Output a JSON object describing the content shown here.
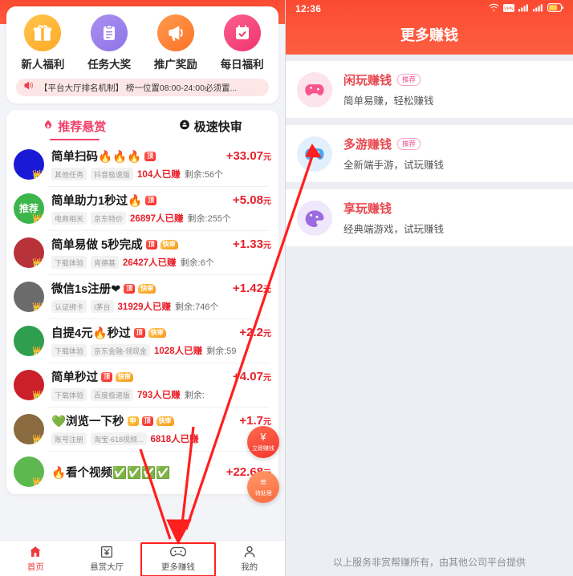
{
  "left": {
    "quick_actions": [
      {
        "label": "新人福利",
        "icon": "gift-icon"
      },
      {
        "label": "任务大奖",
        "icon": "clipboard-icon"
      },
      {
        "label": "推广奖励",
        "icon": "megaphone-icon"
      },
      {
        "label": "每日福利",
        "icon": "calendar-check-icon"
      }
    ],
    "notice": {
      "icon": "speaker-icon",
      "text": "【平台大厅排名机制】 榜一位置08:00-24:00必须置..."
    },
    "tabs": [
      {
        "label": "推荐悬赏",
        "icon": "flame-icon",
        "active": true
      },
      {
        "label": "极速快审",
        "icon": "rocket-icon",
        "active": false
      }
    ],
    "tasks": [
      {
        "title": "简单扫码🔥🔥🔥",
        "badges": [
          "顶"
        ],
        "amount": "+33.07",
        "unit": "元",
        "chips": [
          "其他任务",
          "抖音极速版"
        ],
        "earned": "104人已赚",
        "remain": "剩余:56个",
        "avatar_color": "#1a1ad6",
        "avatar_text": ""
      },
      {
        "title": "简单助力1秒过🔥",
        "badges": [
          "顶"
        ],
        "amount": "+5.08",
        "unit": "元",
        "chips": [
          "电商相关",
          "京东特价"
        ],
        "earned": "26897人已赚",
        "remain": "剩余:255个",
        "avatar_color": "#3cb54a",
        "avatar_text": "推荐"
      },
      {
        "title": "简单易做 5秒完成",
        "badges": [
          "顶",
          "快审"
        ],
        "amount": "+1.33",
        "unit": "元",
        "chips": [
          "下载体验",
          "肯德基"
        ],
        "earned": "26427人已赚",
        "remain": "剩余:6个",
        "avatar_color": "#b8323a",
        "avatar_text": ""
      },
      {
        "title": "微信1s注册❤",
        "badges": [
          "顶",
          "快审"
        ],
        "amount": "+1.42",
        "unit": "元",
        "chips": [
          "认证绑卡",
          "I茅台"
        ],
        "earned": "31929人已赚",
        "remain": "剩余:746个",
        "avatar_color": "#6b6b6b",
        "avatar_text": ""
      },
      {
        "title": "自提4元🔥秒过",
        "badges": [
          "顶",
          "快审"
        ],
        "amount": "+2.2",
        "unit": "元",
        "chips": [
          "下载体验",
          "京东金融-领现金"
        ],
        "earned": "1028人已赚",
        "remain": "剩余:59",
        "avatar_color": "#2f9e4f",
        "avatar_text": ""
      },
      {
        "title": "简单秒过",
        "badges": [
          "顶",
          "快审"
        ],
        "amount": "+4.07",
        "unit": "元",
        "chips": [
          "下载体验",
          "百度极速版"
        ],
        "earned": "793人已赚",
        "remain": "剩余:",
        "avatar_color": "#c9202a",
        "avatar_text": ""
      },
      {
        "title": "💚浏览一下秒",
        "badges": [
          "申",
          "顶",
          "快审"
        ],
        "amount": "+1.7",
        "unit": "元",
        "chips": [
          "账号注册",
          "淘宝-618视频..."
        ],
        "earned": "6818人已赚",
        "remain": "",
        "avatar_color": "#8a6a3f",
        "avatar_text": ""
      },
      {
        "title": "🔥看个视频✅✅✅✅",
        "badges": [],
        "amount": "+22.68",
        "unit": "元",
        "chips": [],
        "earned": "",
        "remain": "",
        "avatar_color": "#5db84f",
        "avatar_text": ""
      }
    ],
    "fabs": [
      {
        "label": "立即赚钱",
        "icon": "yuan-icon",
        "glyph": "¥"
      },
      {
        "label": "待处理",
        "icon": "pending-icon",
        "glyph": "≡"
      }
    ],
    "tabbar": [
      {
        "label": "首页",
        "icon": "home-icon",
        "active": true,
        "highlighted": false
      },
      {
        "label": "悬赏大厅",
        "icon": "money-icon",
        "active": false,
        "highlighted": false
      },
      {
        "label": "更多赚钱",
        "icon": "gamepad-icon",
        "active": false,
        "highlighted": true
      },
      {
        "label": "我的",
        "icon": "person-icon",
        "active": false,
        "highlighted": false
      }
    ]
  },
  "right": {
    "status": {
      "time": "12:36",
      "icons": [
        "wifi-icon",
        "vpn-icon",
        "signal-1-icon",
        "signal-2-icon",
        "battery-icon"
      ]
    },
    "title": "更多赚钱",
    "items": [
      {
        "name": "闲玩赚钱",
        "tag": "推荐",
        "desc": "简单易赚，轻松赚钱",
        "icon": "gamepad-pink-icon",
        "icon_class": "ri-pink"
      },
      {
        "name": "多游赚钱",
        "tag": "推荐",
        "desc": "全新端手游，试玩赚钱",
        "icon": "gamepad-blue-icon",
        "icon_class": "ri-blue"
      },
      {
        "name": "享玩赚钱",
        "tag": "",
        "desc": "经典端游戏，试玩赚钱",
        "icon": "gamepad-purple-icon",
        "icon_class": "ri-purple"
      }
    ],
    "footer": "以上服务非赏帮赚所有，由其他公司平台提供"
  },
  "colors": {
    "brand_red": "#fb4a32",
    "accent_pink": "#f2426b",
    "money_red": "#e8202a",
    "annotation_red": "#ff1f1f"
  }
}
